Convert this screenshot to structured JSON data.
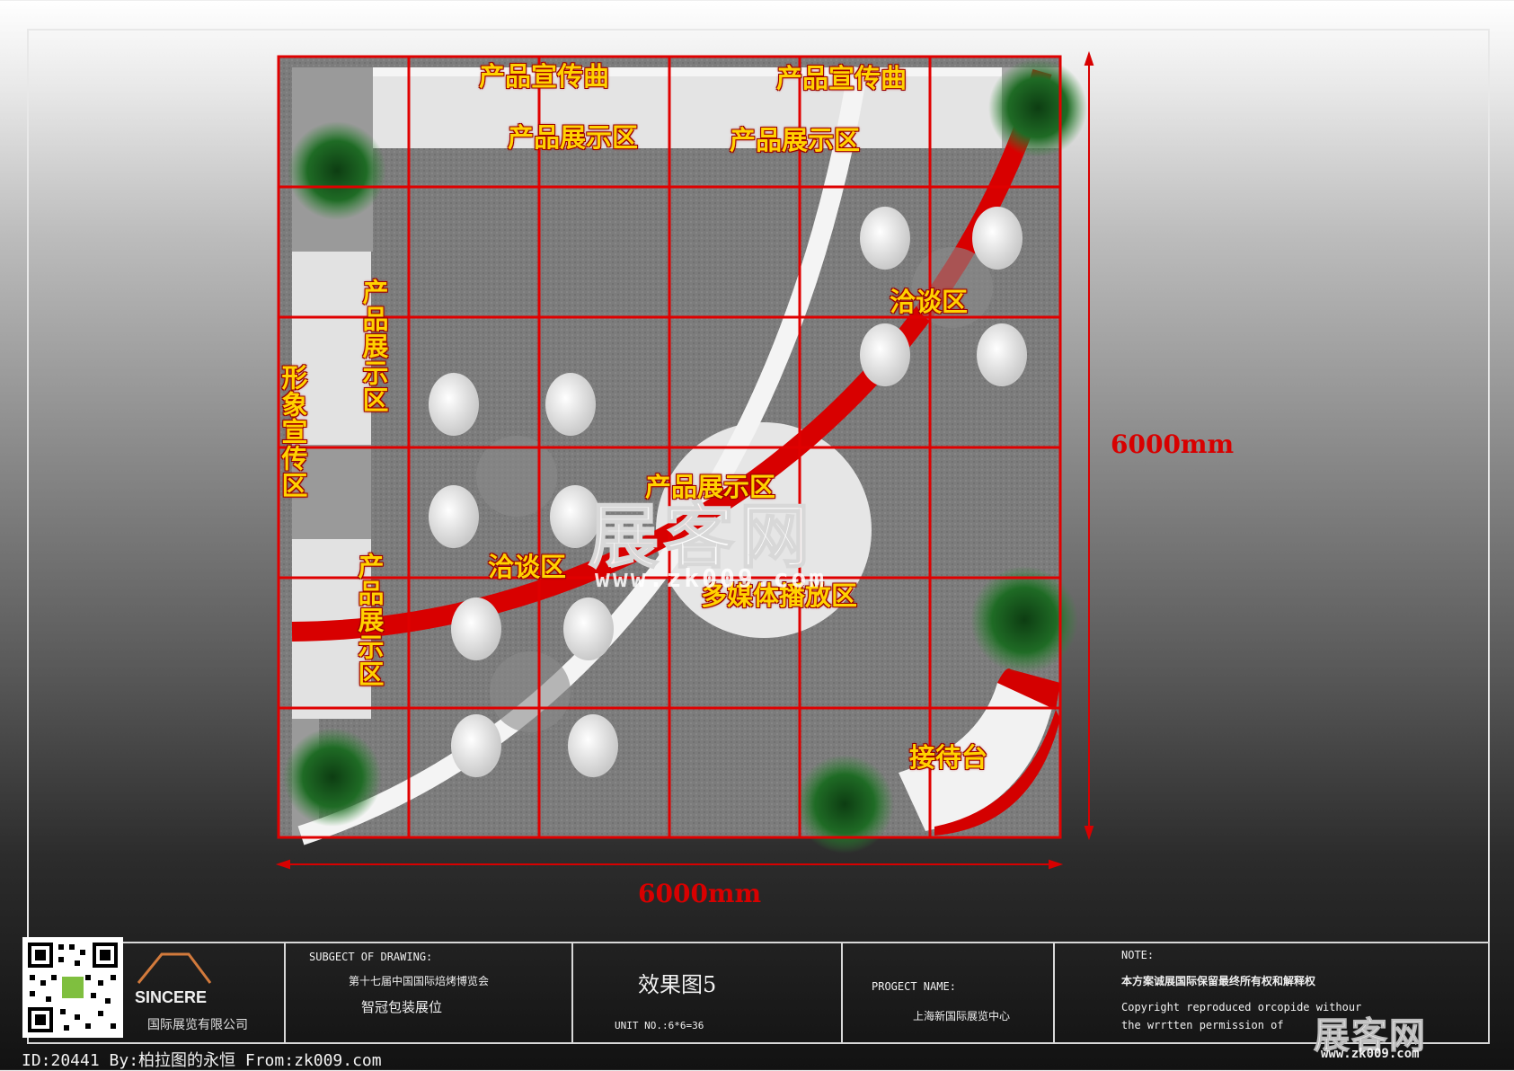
{
  "plan": {
    "labels": {
      "top_left_song": "产品宣传曲",
      "top_right_song": "产品宣传曲",
      "top_left_display": "产品展示区",
      "top_right_display": "产品展示区",
      "right_negotiation": "洽谈区",
      "left_image_promo": "形象宣传区",
      "left_upper_display": "产品展示区",
      "left_lower_display": "产品展示区",
      "center_display": "产品展示区",
      "center_negotiation": "洽谈区",
      "multimedia": "多媒体播放区",
      "reception": "接待台"
    },
    "dim_width": "6000mm",
    "dim_height": "6000mm",
    "colors": {
      "grid": "#e00000",
      "accent_red": "#d40000",
      "floor": "#7a7a7a"
    }
  },
  "watermark": {
    "main": "展客网",
    "url": "www.zk009.com",
    "corner_main": "展客网",
    "corner_url": "www.zk009.com"
  },
  "title_block": {
    "company_logo": "SINCERE",
    "company_name": "国际展览有限公司",
    "subject_heading": "SUBGECT OF DRAWING:",
    "subject_line1": "第十七届中国国际焙烤博览会",
    "subject_line2": "智冠包装展位",
    "drawing_title": "效果图5",
    "unit_no": "UNIT NO.:6*6=36",
    "project_heading": "PROGECT NAME:",
    "project_name": "上海新国际展览中心",
    "note_heading": "NOTE:",
    "note_cn": "本方案诚展国际保留最终所有权和解释权",
    "note_en1": "Copyright reproduced orcopide withour",
    "note_en2": "the wrrtten permission of"
  },
  "footer": {
    "text": "ID:20441 By:柏拉图的永恒 From:zk009.com"
  }
}
